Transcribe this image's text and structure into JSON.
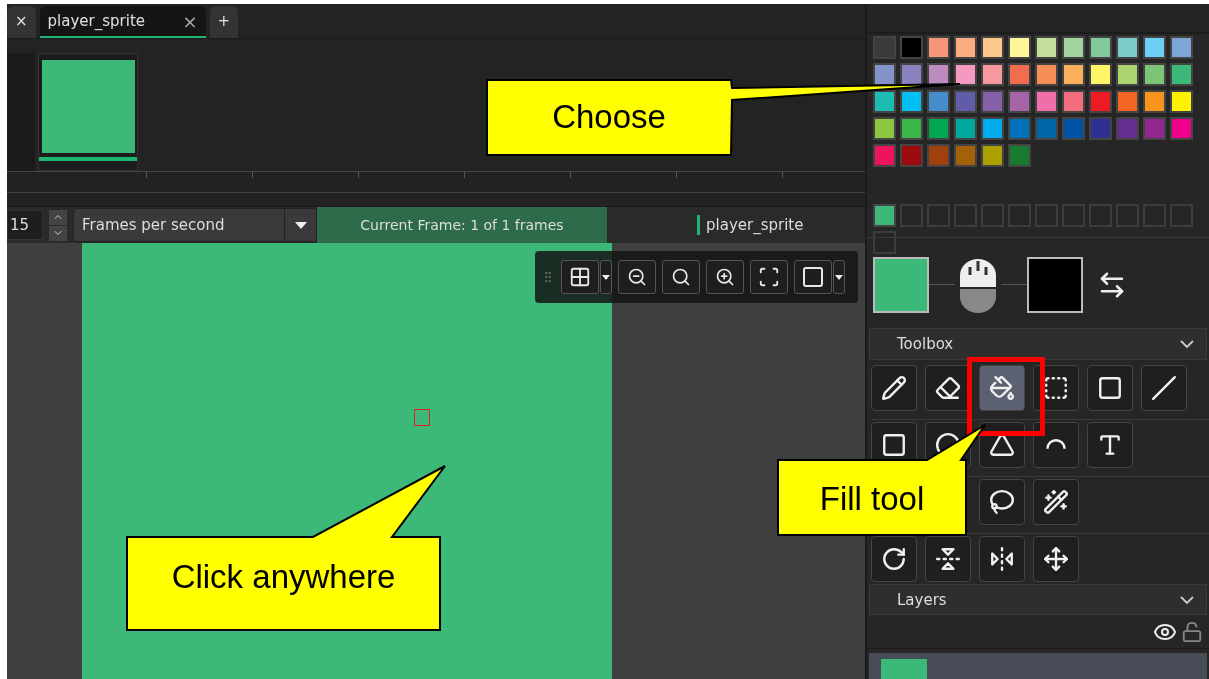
{
  "tabs": [
    {
      "label": "×",
      "selected": false,
      "kind": "close"
    },
    {
      "label": "player_sprite",
      "selected": true,
      "kind": "document",
      "close": "×"
    },
    {
      "label": "+",
      "selected": false,
      "kind": "add"
    }
  ],
  "timeline": {
    "frames": [
      {
        "selected": true
      }
    ]
  },
  "playback": {
    "speed": "15",
    "speed_unit": "Frames per second",
    "current_frame": "Current Frame: 1 of 1 frames",
    "sprite_name": "player_sprite"
  },
  "palette": {
    "swatches": [
      {
        "color": "#3a3a3a"
      },
      {
        "color": "#000000"
      },
      {
        "color": "#f69679"
      },
      {
        "color": "#f9ad81"
      },
      {
        "color": "#fdc68a"
      },
      {
        "color": "#fff799"
      },
      {
        "color": "#c4df9b"
      },
      {
        "color": "#a3d39c"
      },
      {
        "color": "#82ca9c"
      },
      {
        "color": "#7accc8"
      },
      {
        "color": "#6dcff6"
      },
      {
        "color": "#7ea7d8"
      },
      {
        "color": "#8493ca"
      },
      {
        "color": "#8882be"
      },
      {
        "color": "#bc8cbf"
      },
      {
        "color": "#f49ac1"
      },
      {
        "color": "#f6989d"
      },
      {
        "color": "#f26c4f"
      },
      {
        "color": "#f68e56"
      },
      {
        "color": "#fbaf5d"
      },
      {
        "color": "#fff568"
      },
      {
        "color": "#acd372"
      },
      {
        "color": "#7cc576"
      },
      {
        "color": "#3cb878"
      },
      {
        "color": "#1cbbb4"
      },
      {
        "color": "#00bff3"
      },
      {
        "color": "#448ccb"
      },
      {
        "color": "#605ca8"
      },
      {
        "color": "#855fa8"
      },
      {
        "color": "#a763a8"
      },
      {
        "color": "#f06eaa"
      },
      {
        "color": "#f26d7d"
      },
      {
        "color": "#ed1c24"
      },
      {
        "color": "#f26522"
      },
      {
        "color": "#f7941d"
      },
      {
        "color": "#fff200"
      },
      {
        "color": "#8dc73f"
      },
      {
        "color": "#39b54a"
      },
      {
        "color": "#00a651"
      },
      {
        "color": "#00a99d"
      },
      {
        "color": "#00aeef"
      },
      {
        "color": "#0072bc"
      },
      {
        "color": "#0066a8"
      },
      {
        "color": "#0054a6"
      },
      {
        "color": "#2e3192"
      },
      {
        "color": "#662d91"
      },
      {
        "color": "#92278f"
      },
      {
        "color": "#ec008c"
      },
      {
        "color": "#ed145b"
      },
      {
        "color": "#9e0b0f"
      },
      {
        "color": "#a0410d"
      },
      {
        "color": "#a36209"
      },
      {
        "color": "#aba000"
      },
      {
        "color": "#197b30"
      }
    ],
    "custom": [
      {
        "kind": "filled",
        "color": "#3cb878"
      },
      {
        "kind": "empty"
      },
      {
        "kind": "empty"
      },
      {
        "kind": "empty"
      },
      {
        "kind": "empty"
      },
      {
        "kind": "empty"
      },
      {
        "kind": "empty"
      },
      {
        "kind": "empty"
      },
      {
        "kind": "empty"
      },
      {
        "kind": "empty"
      },
      {
        "kind": "empty"
      },
      {
        "kind": "empty"
      },
      {
        "kind": "empty"
      }
    ]
  },
  "primary_color": {
    "color": "#3cb878"
  },
  "secondary_color": {
    "color": "#000000"
  },
  "toolbox": {
    "title": "Toolbox",
    "rows": [
      {
        "tools": [
          {
            "kind": "pencil",
            "selected": false
          },
          {
            "kind": "eraser",
            "selected": false
          },
          {
            "kind": "fill",
            "selected": true
          },
          {
            "kind": "select-dotted",
            "selected": false
          },
          {
            "kind": "select",
            "selected": false
          },
          {
            "kind": "line",
            "selected": false
          }
        ]
      },
      {
        "tools": [
          {
            "kind": "rectangle",
            "selected": false
          },
          {
            "kind": "ellipse",
            "selected": false
          },
          {
            "kind": "polygon",
            "selected": false
          },
          {
            "kind": "arc",
            "selected": false
          },
          {
            "kind": "text",
            "selected": false
          }
        ]
      },
      {
        "tools": [
          {
            "kind": "lasso",
            "selected": false
          },
          {
            "kind": "wand",
            "selected": false
          }
        ]
      },
      {
        "tools": [
          {
            "kind": "rotate",
            "selected": false
          },
          {
            "kind": "flip-vertical",
            "selected": false
          },
          {
            "kind": "flip-horizontal",
            "selected": false
          },
          {
            "kind": "move",
            "selected": false
          }
        ]
      }
    ]
  },
  "layers": {
    "title": "Layers",
    "items": [
      {
        "selected": true
      }
    ]
  },
  "callouts": [
    {
      "text": "Choose"
    },
    {
      "text": "Fill tool"
    },
    {
      "text": "Click anywhere"
    }
  ]
}
